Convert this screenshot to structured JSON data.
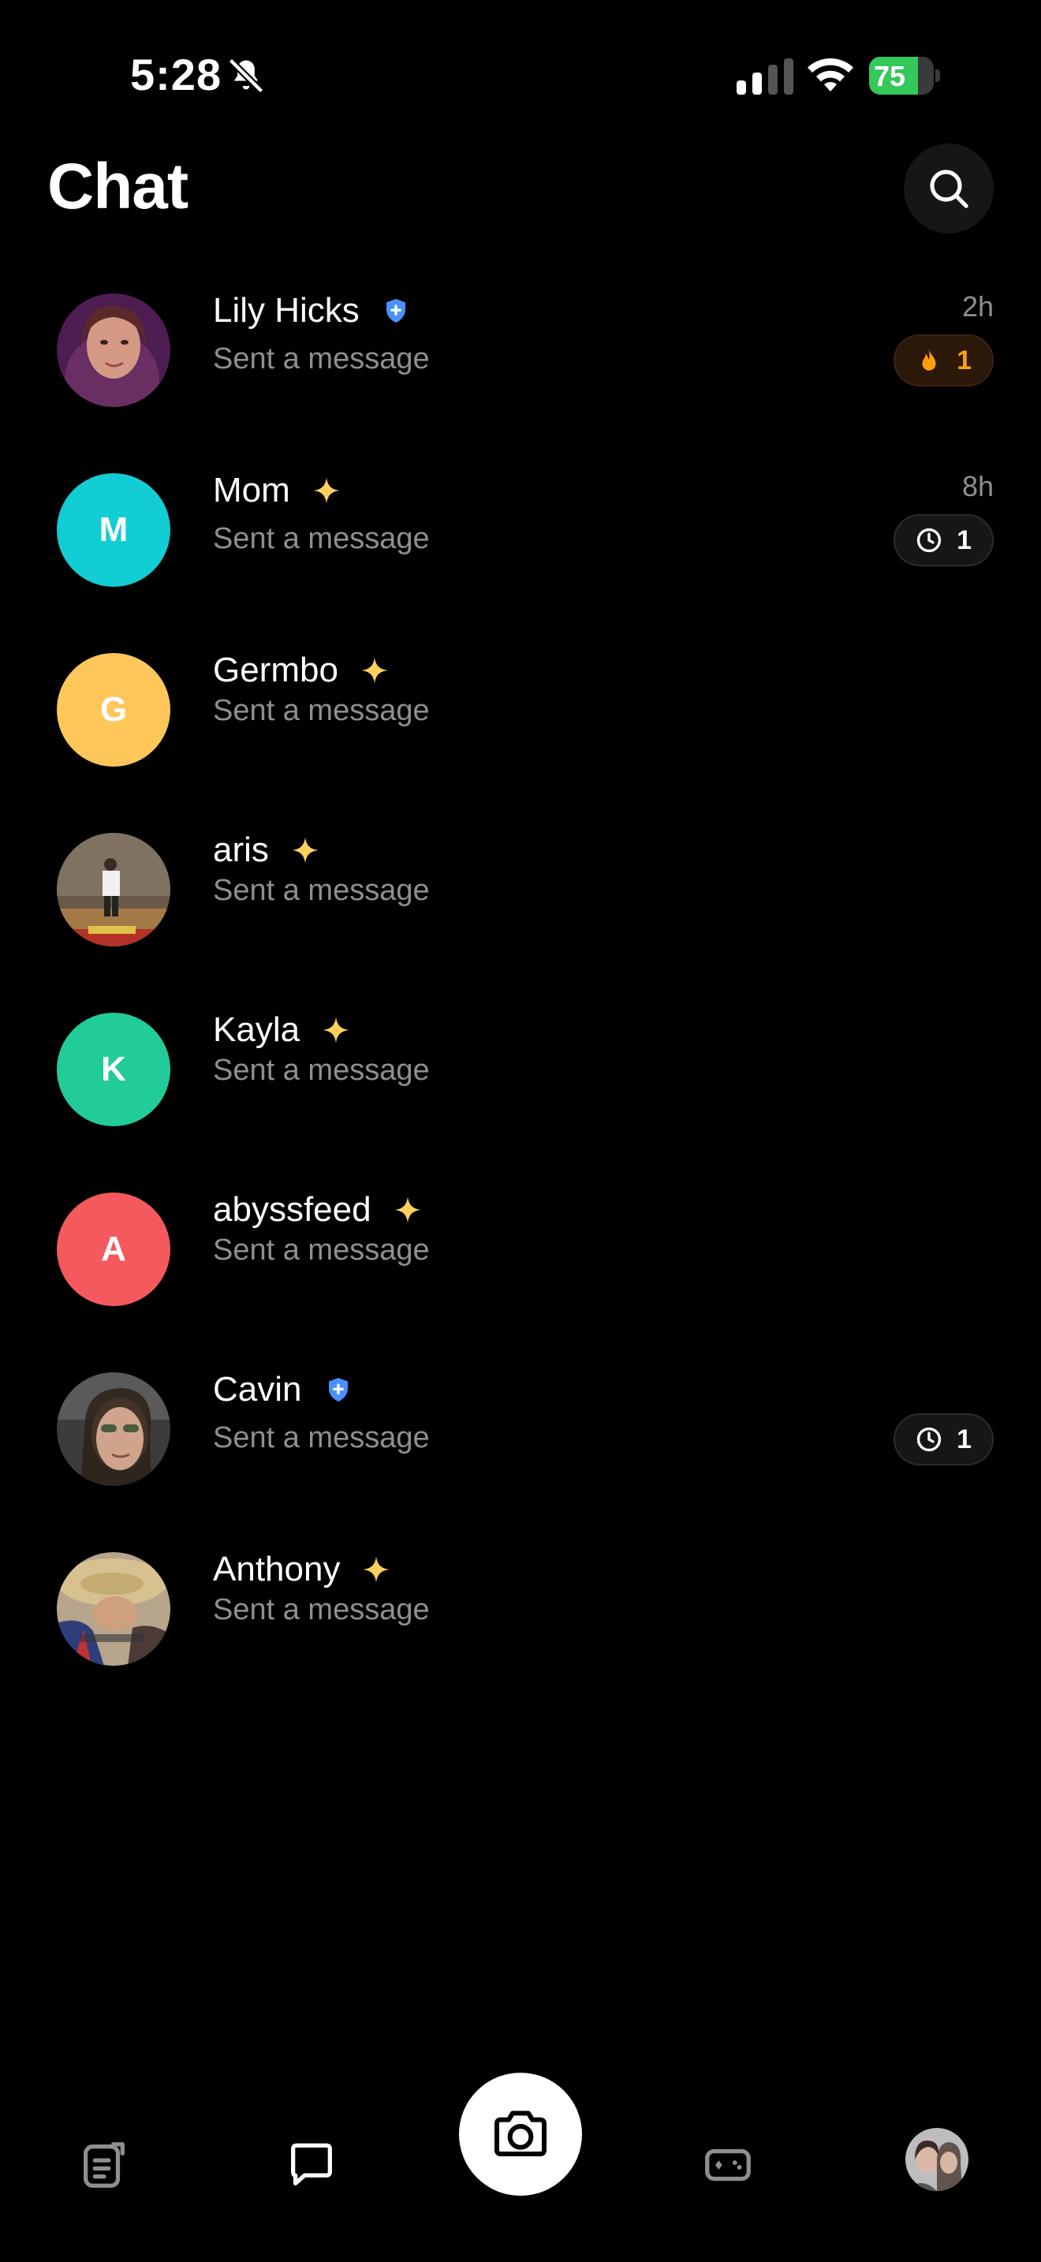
{
  "status_bar": {
    "time": "5:28",
    "battery": "75",
    "battery_level": 0.75
  },
  "header": {
    "title": "Chat"
  },
  "chats": [
    {
      "name": "Lily Hicks",
      "subtitle": "Sent a message",
      "time": "2h",
      "badge": "shield",
      "pill": {
        "type": "streak",
        "count": "1"
      }
    },
    {
      "name": "Mom",
      "initial": "M",
      "avatar_color": "#12cdd4",
      "subtitle": "Sent a message",
      "time": "8h",
      "badge": "sparkle",
      "pill": {
        "type": "timer",
        "count": "1"
      }
    },
    {
      "name": "Germbo",
      "initial": "G",
      "avatar_color": "#ffc75a",
      "subtitle": "Sent a message",
      "badge": "sparkle"
    },
    {
      "name": "aris",
      "subtitle": "Sent a message",
      "badge": "sparkle"
    },
    {
      "name": "Kayla",
      "initial": "K",
      "avatar_color": "#22cc98",
      "subtitle": "Sent a message",
      "badge": "sparkle"
    },
    {
      "name": "abyssfeed",
      "initial": "A",
      "avatar_color": "#f4595e",
      "subtitle": "Sent a message",
      "badge": "sparkle"
    },
    {
      "name": "Cavin",
      "subtitle": "Sent a message",
      "badge": "shield",
      "pill": {
        "type": "timer",
        "count": "1"
      }
    },
    {
      "name": "Anthony",
      "subtitle": "Sent a message",
      "badge": "sparkle"
    }
  ],
  "icons": {
    "search": "search-icon",
    "notifications_muted": "bell-slash-icon",
    "signal": "cellular-signal-icon",
    "wifi": "wifi-icon",
    "verified": "shield-plus-icon",
    "friend": "sparkle-icon",
    "streak": "fire-icon",
    "timer": "clock-icon",
    "nav": [
      "stories-icon",
      "chat-bubble-icon",
      "camera-icon",
      "games-icon",
      "profile-avatar"
    ]
  },
  "colors": {
    "sparkle": "#ffd15c",
    "shield": "#4a90ff",
    "streak_text": "#ff9f0a",
    "battery": "#34c759"
  }
}
